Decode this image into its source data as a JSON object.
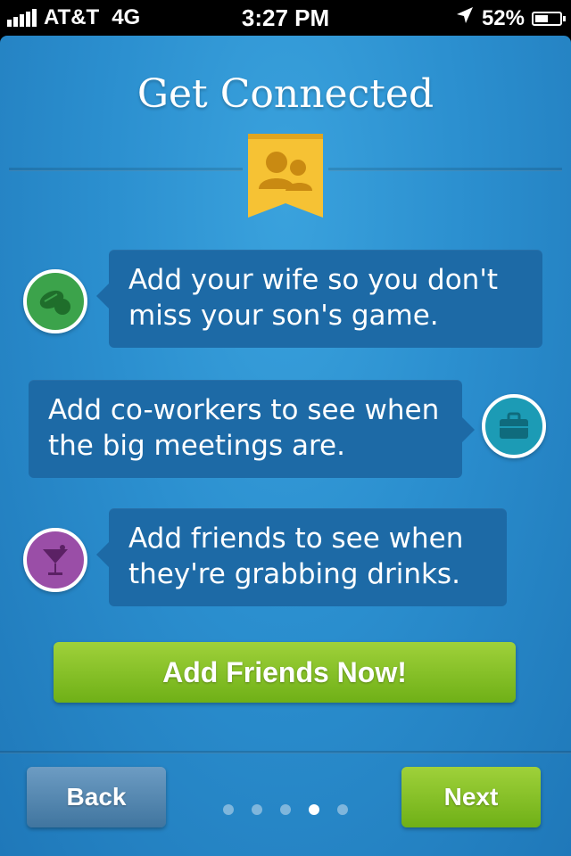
{
  "status_bar": {
    "carrier": "AT&T",
    "network": "4G",
    "time": "3:27 PM",
    "battery_percent": "52%",
    "battery_level": 0.52,
    "signal_bars": 5
  },
  "page": {
    "title": "Get Connected",
    "ribbon_icon": "people-icon"
  },
  "items": [
    {
      "text_line1": "Add your wife so you don't",
      "text_line2": "miss your son's game.",
      "icon": "sports-ball-icon",
      "icon_color": "#3ca34b",
      "side": "left"
    },
    {
      "text_line1": "Add co-workers to see when",
      "text_line2": "the big meetings are.",
      "icon": "briefcase-icon",
      "icon_color": "#1c9bb5",
      "side": "right"
    },
    {
      "text_line1": "Add friends to see when",
      "text_line2": "they're grabbing drinks.",
      "icon": "cocktail-icon",
      "icon_color": "#9a4ea7",
      "side": "left"
    }
  ],
  "cta": {
    "label": "Add Friends Now!"
  },
  "nav": {
    "back_label": "Back",
    "next_label": "Next",
    "page_count": 5,
    "active_page": 4
  },
  "colors": {
    "accent_green": "#7dbd1f",
    "background_blue": "#2b8fcf",
    "bubble": "#1d6aa6",
    "ribbon_yellow": "#f6c234"
  }
}
